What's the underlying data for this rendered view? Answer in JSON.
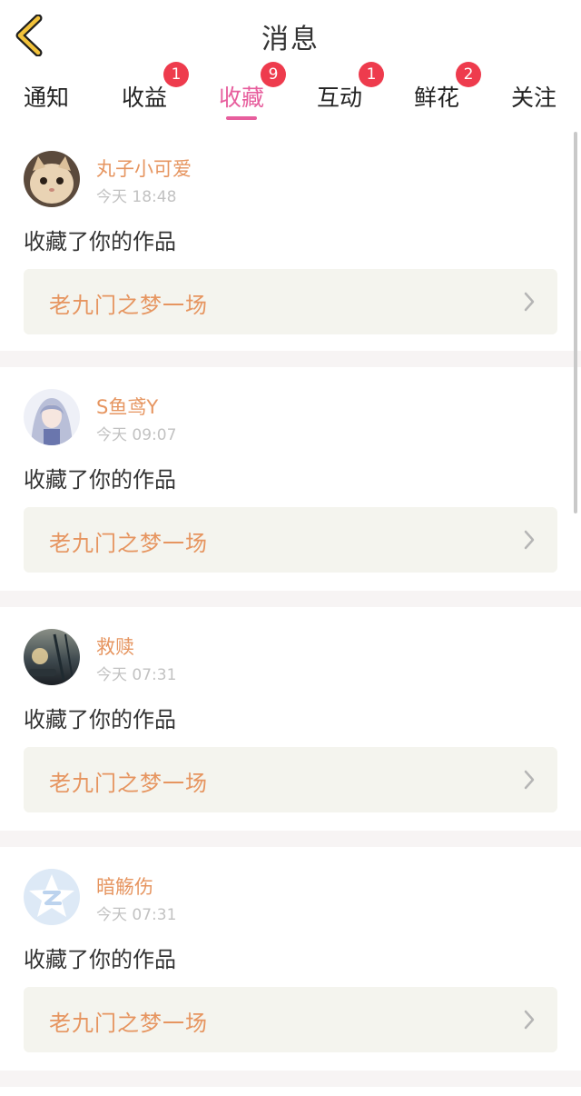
{
  "header": {
    "title": "消息"
  },
  "tabs": [
    {
      "label": "通知",
      "badge": ""
    },
    {
      "label": "收益",
      "badge": "1"
    },
    {
      "label": "收藏",
      "badge": "9",
      "active": true
    },
    {
      "label": "互动",
      "badge": "1"
    },
    {
      "label": "鲜花",
      "badge": "2"
    },
    {
      "label": "关注",
      "badge": ""
    }
  ],
  "feed": [
    {
      "username": "丸子小可爱",
      "time": "今天 18:48",
      "message": "收藏了你的作品",
      "work_title": "老九门之梦一场",
      "avatar": "cat-photo"
    },
    {
      "username": "S鱼鸢Y",
      "time": "今天 09:07",
      "message": "收藏了你的作品",
      "work_title": "老九门之梦一场",
      "avatar": "anime-girl"
    },
    {
      "username": "救赎",
      "time": "今天 07:31",
      "message": "收藏了你的作品",
      "work_title": "老九门之梦一场",
      "avatar": "dusk-landscape"
    },
    {
      "username": "暗觞伤",
      "time": "今天 07:31",
      "message": "收藏了你的作品",
      "work_title": "老九门之梦一场",
      "avatar": "qzone-star"
    }
  ],
  "colors": {
    "accent": "#e75e9d",
    "username": "#e69560",
    "badge": "#ee3b4d",
    "work_bg": "#f4f4ee"
  }
}
